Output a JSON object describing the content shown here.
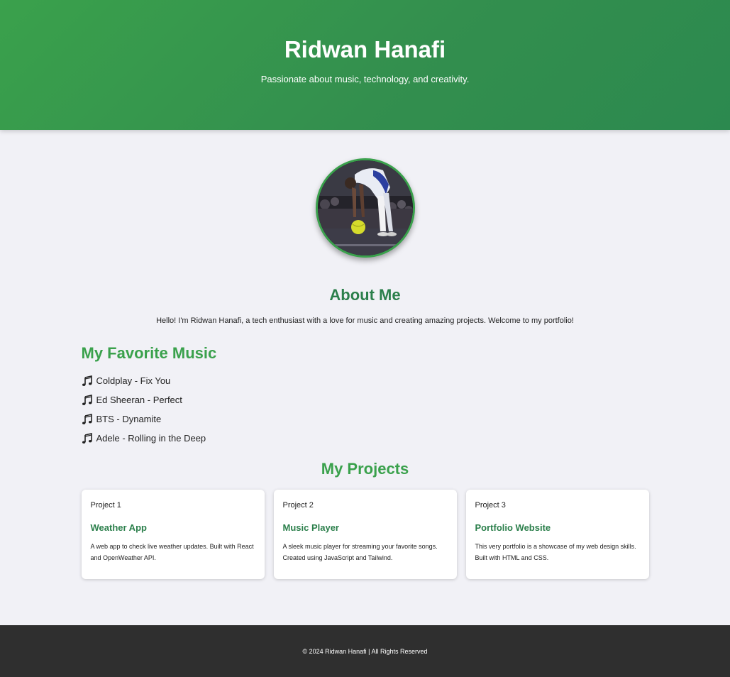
{
  "header": {
    "name": "Ridwan Hanafi",
    "tagline": "Passionate about music, technology, and creativity."
  },
  "profile": {
    "photo": "profile-photo-futsal-player",
    "accent_color": "#3aa14c"
  },
  "about": {
    "title": "About Me",
    "text": "Hello! I'm Ridwan Hanafi, a tech enthusiast with a love for music and creating amazing projects. Welcome to my portfolio!"
  },
  "music": {
    "title": "My Favorite Music",
    "icon": "music-note-icon",
    "items": [
      {
        "label": "Coldplay - Fix You"
      },
      {
        "label": "Ed Sheeran - Perfect"
      },
      {
        "label": "BTS - Dynamite"
      },
      {
        "label": "Adele - Rolling in the Deep"
      }
    ]
  },
  "projects": {
    "title": "My Projects",
    "items": [
      {
        "number": "Project 1",
        "name": "Weather App",
        "description": "A web app to check live weather updates. Built with React and OpenWeather API."
      },
      {
        "number": "Project 2",
        "name": "Music Player",
        "description": "A sleek music player for streaming your favorite songs. Created using JavaScript and Tailwind."
      },
      {
        "number": "Project 3",
        "name": "Portfolio Website",
        "description": "This very portfolio is a showcase of my web design skills. Built with HTML and CSS."
      }
    ]
  },
  "footer": {
    "text": "© 2024 Ridwan Hanafi | All Rights Reserved"
  },
  "colors": {
    "header_green": "#3aa14c",
    "heading_dark_green": "#2b7f4b",
    "page_background": "#f1f1f6",
    "footer_background": "#2f2f2f"
  }
}
